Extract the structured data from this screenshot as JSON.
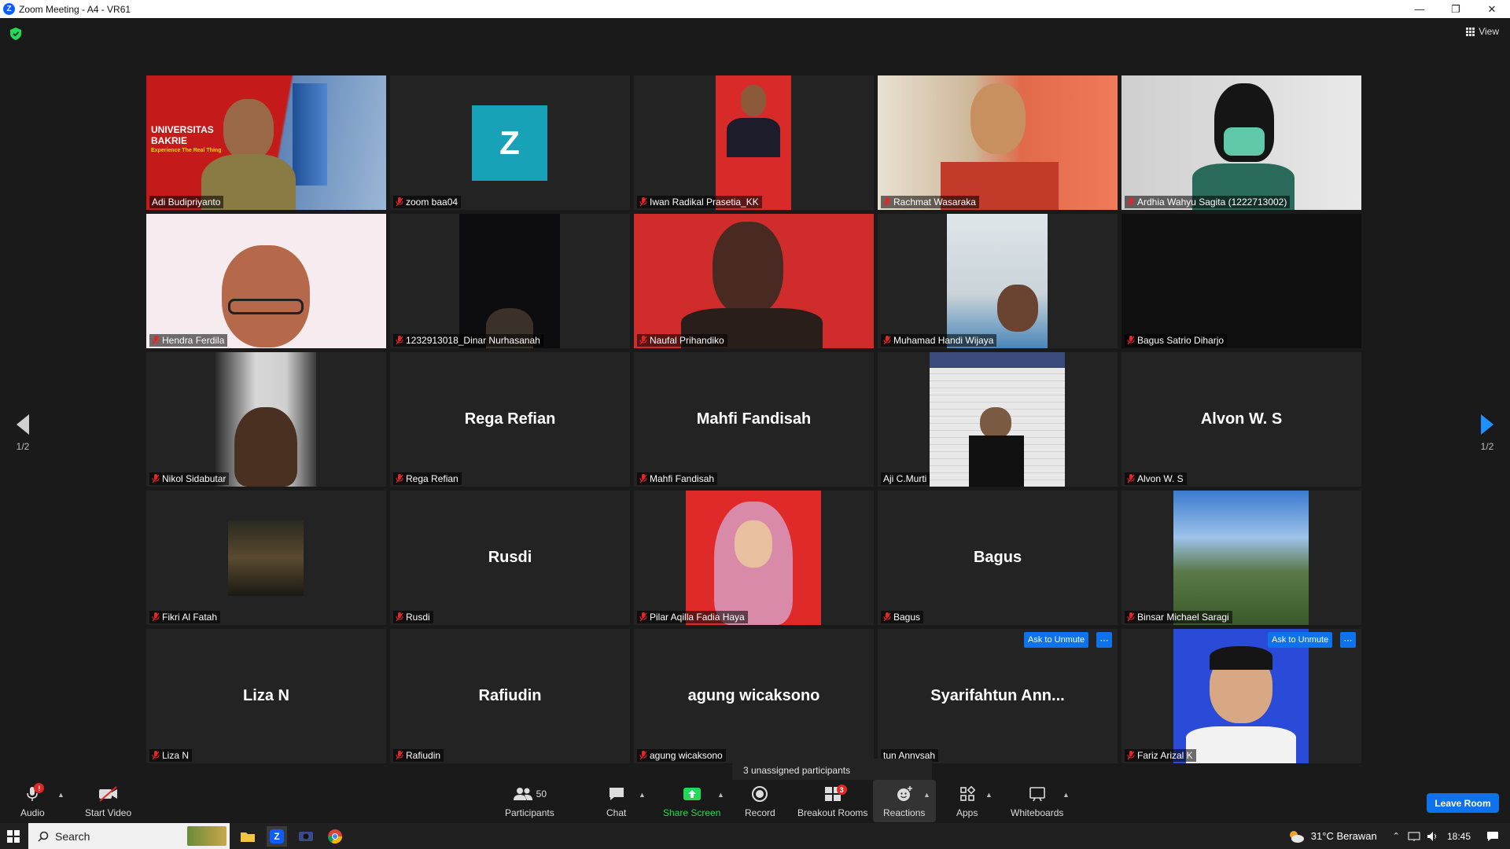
{
  "window": {
    "title": "Zoom Meeting - A4 - VR61"
  },
  "view_label": "View",
  "page_indicator": "1/2",
  "participants": [
    {
      "name": "Adi Budipriyanto",
      "muted": false,
      "kind": "video",
      "active": true
    },
    {
      "name": "zoom baa04",
      "muted": true,
      "kind": "avatar",
      "avatar_letter": "Z"
    },
    {
      "name": "Iwan Radikal Prasetia_KK",
      "muted": true,
      "kind": "video"
    },
    {
      "name": "Rachmat Wasaraka",
      "muted": true,
      "kind": "video"
    },
    {
      "name": "Ardhia Wahyu Sagita (1222713002)",
      "muted": true,
      "kind": "video"
    },
    {
      "name": "Hendra Ferdila",
      "muted": true,
      "kind": "video"
    },
    {
      "name": "1232913018_Dinar Nurhasanah",
      "muted": true,
      "kind": "video"
    },
    {
      "name": "Naufal Prihandiko",
      "muted": true,
      "kind": "video"
    },
    {
      "name": "Muhamad Handi Wijaya",
      "muted": true,
      "kind": "video"
    },
    {
      "name": "Bagus Satrio Diharjo",
      "muted": true,
      "kind": "video"
    },
    {
      "name": "Nikol Sidabutar",
      "muted": true,
      "kind": "video"
    },
    {
      "name": "Rega Refian",
      "muted": true,
      "kind": "name",
      "display_name": "Rega Refian"
    },
    {
      "name": "Mahfi Fandisah",
      "muted": true,
      "kind": "name",
      "display_name": "Mahfi Fandisah"
    },
    {
      "name": "Aji C.Murti",
      "muted": false,
      "kind": "video"
    },
    {
      "name": "Alvon W. S",
      "muted": true,
      "kind": "name",
      "display_name": "Alvon W. S"
    },
    {
      "name": "Fikri Al Fatah",
      "muted": true,
      "kind": "video"
    },
    {
      "name": "Rusdi",
      "muted": true,
      "kind": "name",
      "display_name": "Rusdi"
    },
    {
      "name": "Pilar Aqilla Fadia Haya",
      "muted": true,
      "kind": "video"
    },
    {
      "name": "Bagus",
      "muted": true,
      "kind": "name",
      "display_name": "Bagus"
    },
    {
      "name": "Binsar Michael Saragi",
      "muted": true,
      "kind": "video"
    },
    {
      "name": "Liza N",
      "muted": true,
      "kind": "name",
      "display_name": "Liza N"
    },
    {
      "name": "Rafiudin",
      "muted": true,
      "kind": "name",
      "display_name": "Rafiudin"
    },
    {
      "name": "agung wicaksono",
      "muted": true,
      "kind": "name",
      "display_name": "agung wicaksono"
    },
    {
      "name": "tun Annysah",
      "muted": false,
      "kind": "name",
      "display_name": "Syarifahtun  Ann...",
      "ask_to_unmute": "Ask to Unmute"
    },
    {
      "name": "Fariz Arizal K",
      "muted": true,
      "kind": "video",
      "ask_to_unmute": "Ask to Unmute"
    }
  ],
  "tooltip": "3 unassigned participants",
  "toolbar": {
    "audio": "Audio",
    "start_video": "Start Video",
    "participants": "Participants",
    "participants_count": "50",
    "chat": "Chat",
    "share_screen": "Share Screen",
    "record": "Record",
    "breakout_rooms": "Breakout Rooms",
    "breakout_badge": "3",
    "reactions": "Reactions",
    "apps": "Apps",
    "whiteboards": "Whiteboards",
    "leave": "Leave Room",
    "audio_badge": "!"
  },
  "taskbar": {
    "search": "Search",
    "weather": "31°C  Berawan",
    "time": "18:45"
  },
  "colors": {
    "accent": "#0e72ed",
    "active_speaker": "#d8e33b",
    "share_green": "#23d959",
    "mute_red": "#e02828"
  }
}
